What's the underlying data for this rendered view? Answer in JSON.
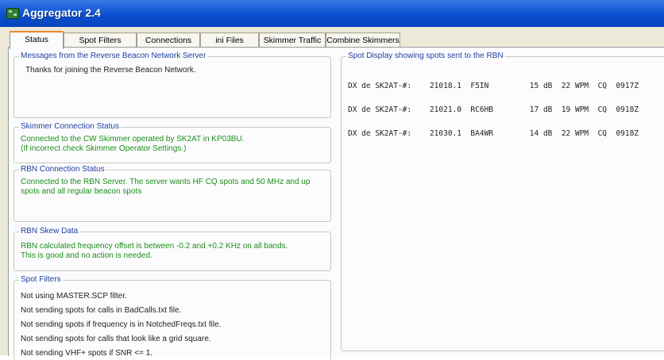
{
  "window": {
    "title": "Aggregator 2.4"
  },
  "tabs": [
    {
      "label": "Status"
    },
    {
      "label": "Spot Filters"
    },
    {
      "label": "Connections"
    },
    {
      "label": "ini Files"
    },
    {
      "label": "Skimmer Traffic"
    },
    {
      "label": "Combine Skimmers"
    }
  ],
  "messages": {
    "legend": "Messages from the Reverse Beacon Network Server",
    "text": "Thanks for joining the Reverse Beacon Network."
  },
  "skimmer_status": {
    "legend": "Skimmer Connection Status",
    "text": "Connected to the CW Skimmer operated by SK2AT in KP03BU.\n(If incorrect check Skimmer Operator Settings.)"
  },
  "rbn_status": {
    "legend": "RBN Connection Status",
    "text": "Connected to the RBN Server.  The server wants HF CQ spots and 50 MHz and up\nspots and all regular beacon spots"
  },
  "skew": {
    "legend": "RBN Skew Data",
    "text": "RBN calculated frequency offset is between -0.2 and +0.2 KHz on all bands.\nThis is good and no action is needed."
  },
  "spot_filters": {
    "legend": "Spot Filters",
    "lines": [
      "Not using MASTER.SCP filter.",
      "Not sending spots for calls in BadCalls.txt file.",
      "Not sending spots if frequency is in NotchedFreqs.txt file.",
      "Not sending spots for calls that look like a grid square.",
      "Not sending VHF+ spots if SNR <= 1."
    ]
  },
  "spot_display": {
    "legend": "Spot Display showing spots sent to the RBN",
    "lines": [
      "DX de SK2AT-#:    21018.1  F5IN         15 dB  22 WPM  CQ  0917Z",
      "DX de SK2AT-#:    21021.0  RC6HB        17 dB  19 WPM  CQ  0918Z",
      "DX de SK2AT-#:    21030.1  BA4WR        14 dB  22 WPM  CQ  0918Z"
    ]
  }
}
